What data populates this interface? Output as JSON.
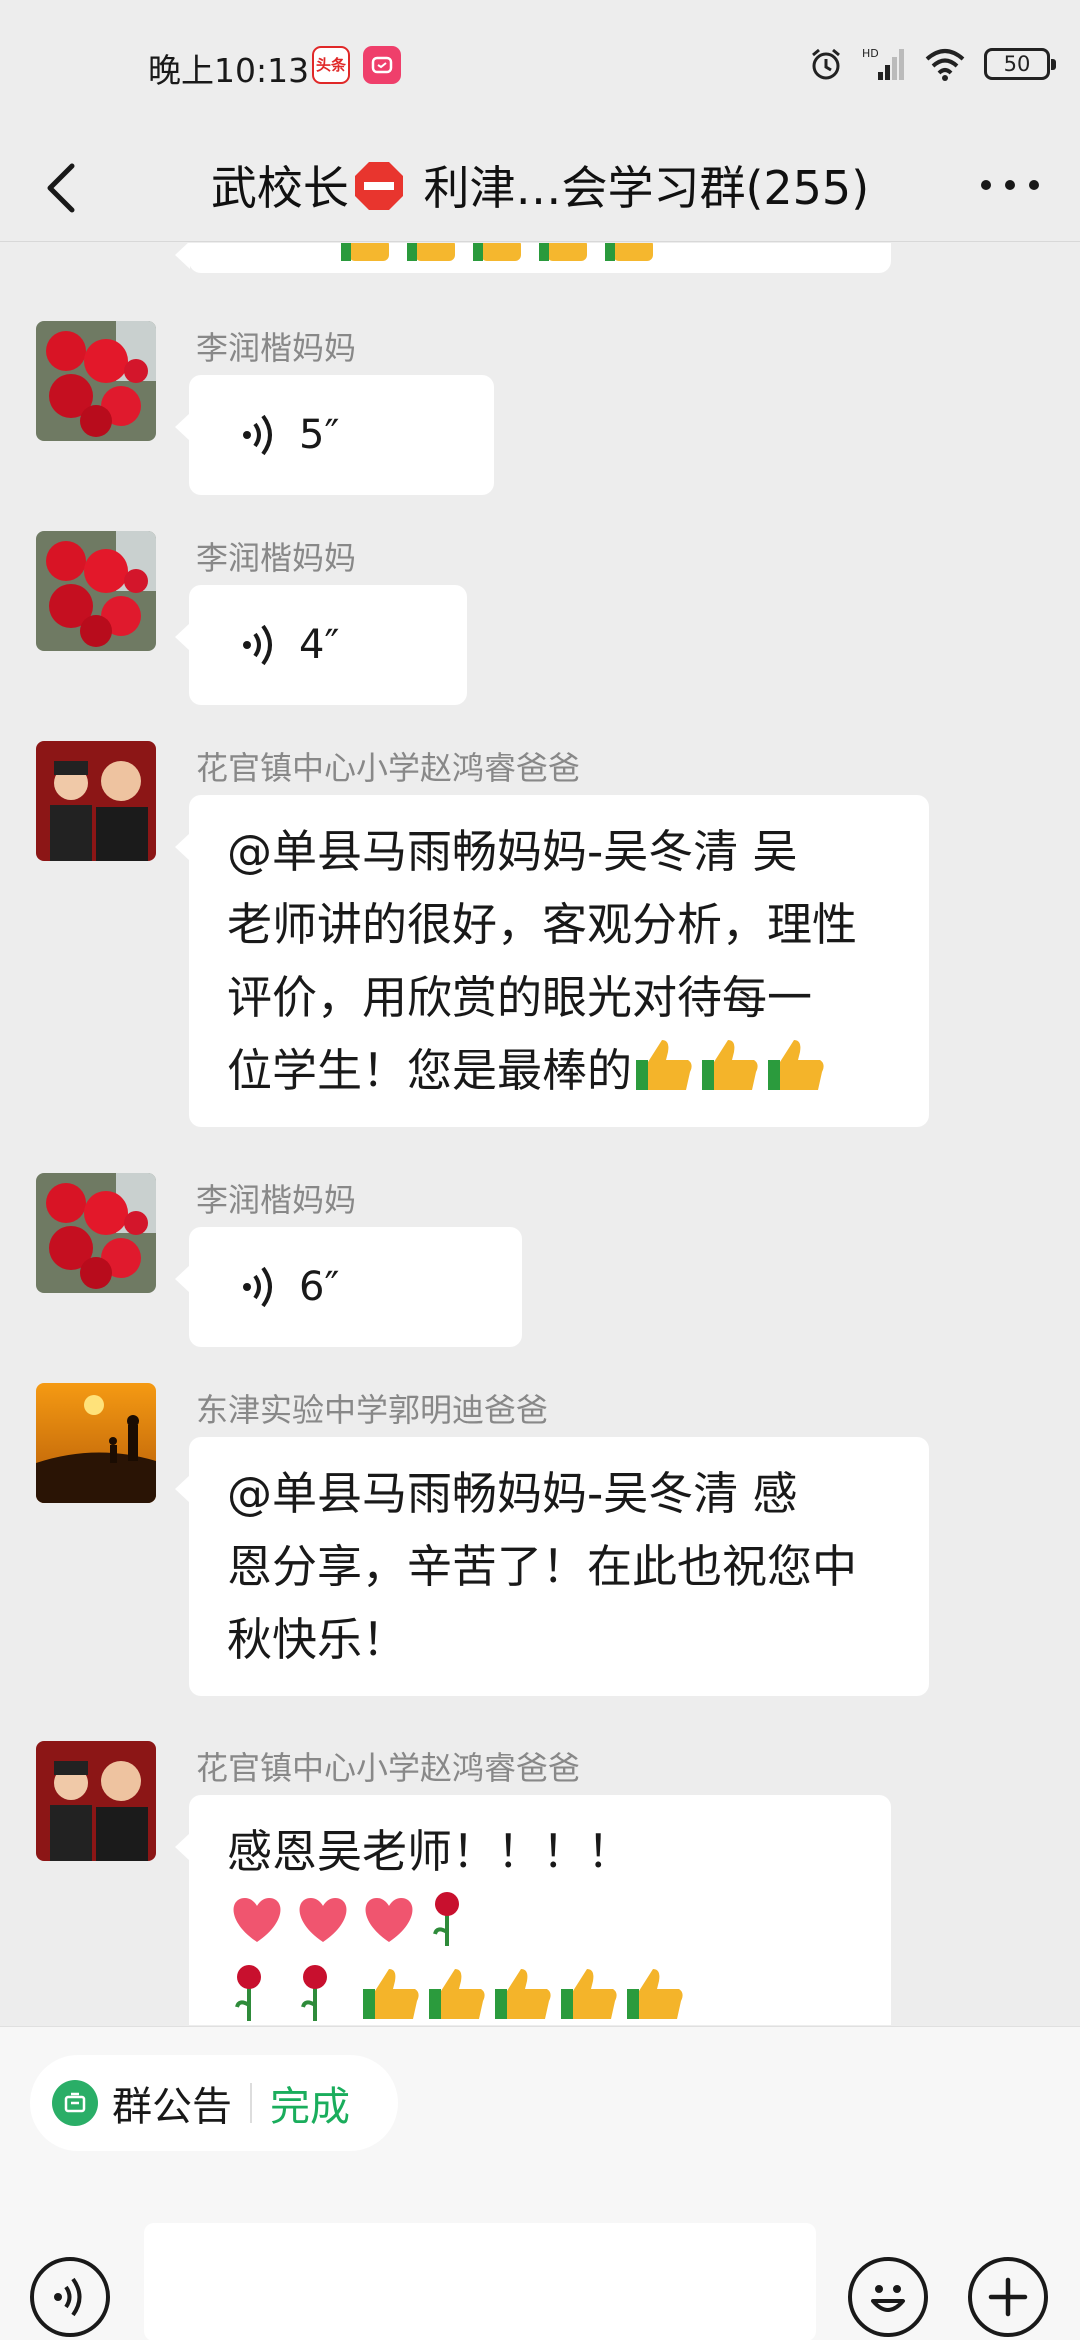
{
  "status_bar": {
    "time": "晚上10:13",
    "toutiao_label": "头条",
    "network": "HD",
    "battery": "50"
  },
  "header": {
    "title_part1": "武校长",
    "title_part2": " 利津…会学习群(255)"
  },
  "messages": [
    {
      "type": "voice",
      "sender": "李润楷妈妈",
      "duration": "5″"
    },
    {
      "type": "voice",
      "sender": "李润楷妈妈",
      "duration": "4″"
    },
    {
      "type": "text",
      "sender": "花官镇中心小学赵鸿睿爸爸",
      "lines": [
        "@单县马雨畅妈妈-吴冬清  吴",
        "老师讲的很好，客观分析，理性",
        "评价，用欣赏的眼光对待每一",
        "位学生！您是最棒的"
      ]
    },
    {
      "type": "voice",
      "sender": "李润楷妈妈",
      "duration": "6″"
    },
    {
      "type": "text",
      "sender": "东津实验中学郭明迪爸爸",
      "lines": [
        "@单县马雨畅妈妈-吴冬清  感",
        "恩分享，辛苦了！在此也祝您中",
        "秋快乐！"
      ]
    },
    {
      "type": "text",
      "sender": "花官镇中心小学赵鸿睿爸爸",
      "lines": [
        "感恩吴老师！！！！"
      ]
    }
  ],
  "announcement": {
    "label": "群公告",
    "done": "完成"
  },
  "colors": {
    "background": "#ededed",
    "bubble": "#ffffff",
    "accent_green": "#1aad5c"
  }
}
